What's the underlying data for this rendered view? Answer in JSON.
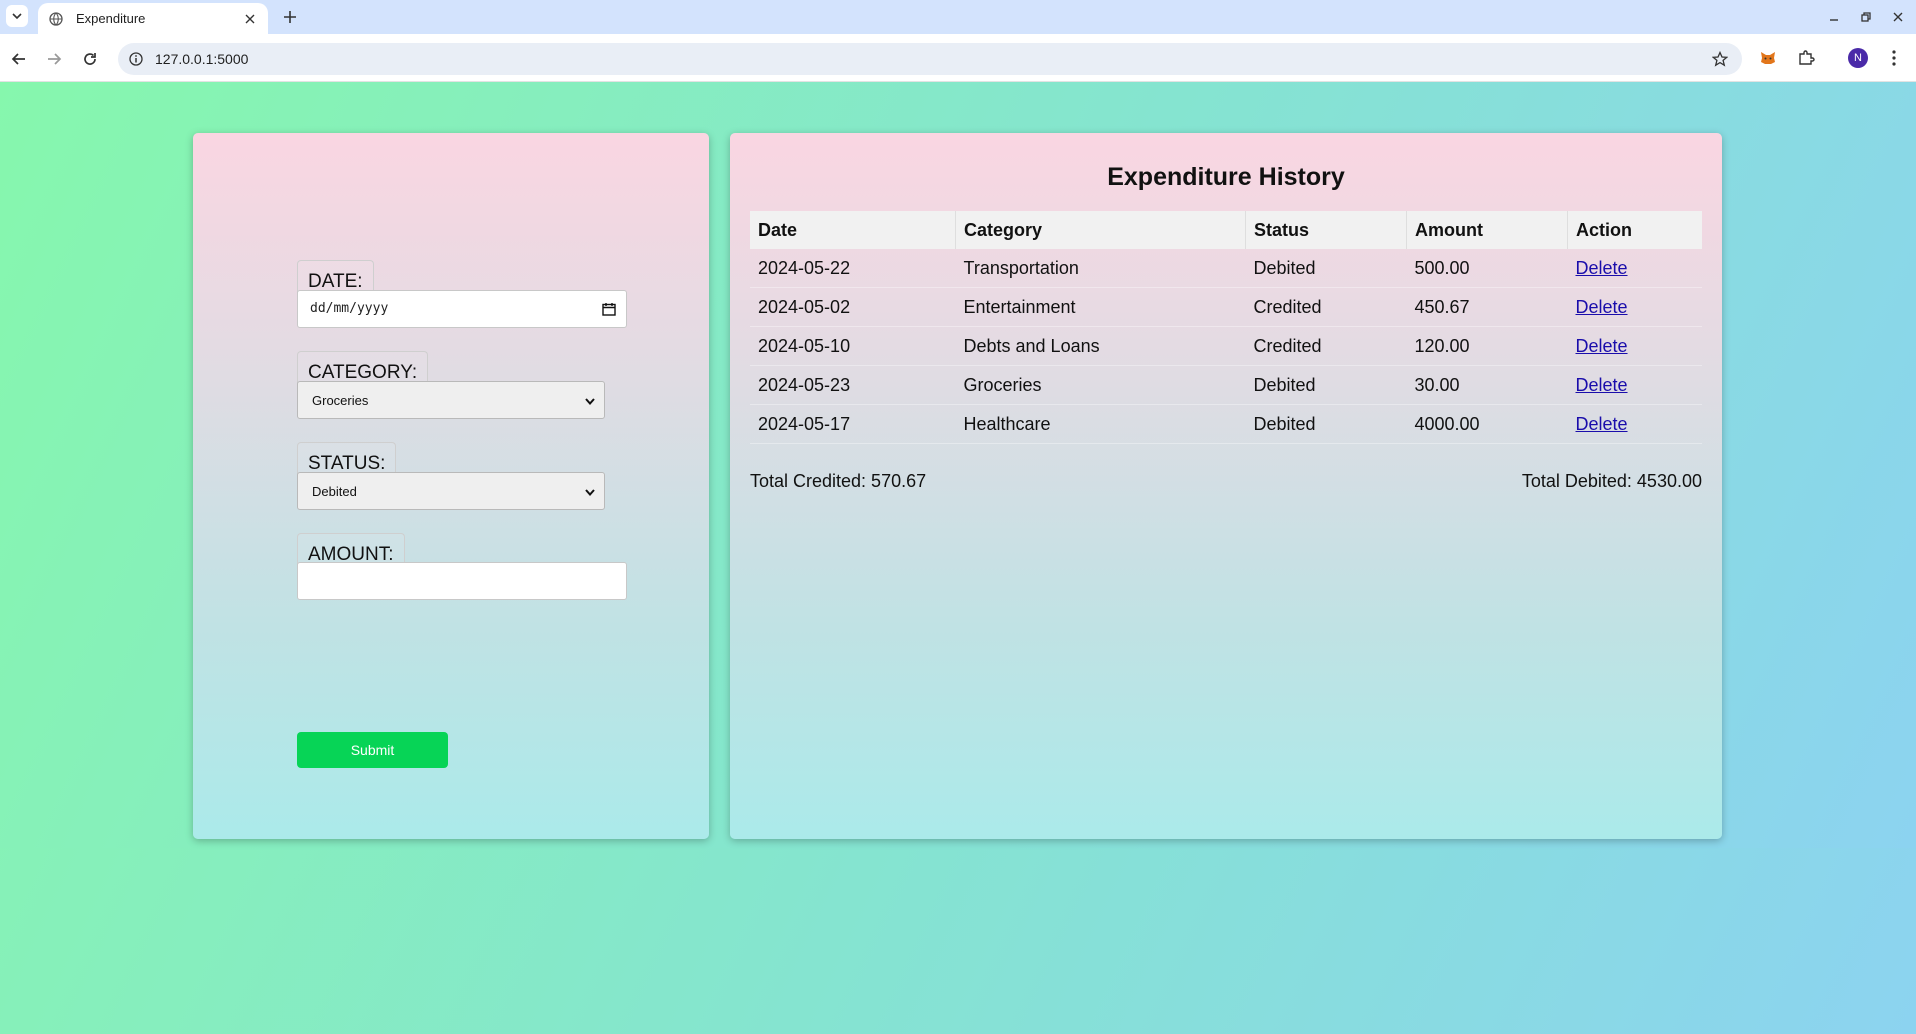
{
  "browser": {
    "tab_title": "Expenditure",
    "url": "127.0.0.1:5000",
    "profile_initial": "N"
  },
  "form": {
    "date_label": "DATE:",
    "date_placeholder": "dd/mm/yyyy",
    "category_label": "CATEGORY:",
    "category_value": "Groceries",
    "status_label": "STATUS:",
    "status_value": "Debited",
    "amount_label": "AMOUNT:",
    "amount_value": "",
    "submit_label": "Submit"
  },
  "history": {
    "title": "Expenditure History",
    "columns": [
      "Date",
      "Category",
      "Status",
      "Amount",
      "Action"
    ],
    "rows": [
      {
        "date": "2024-05-22",
        "category": "Transportation",
        "status": "Debited",
        "amount": "500.00",
        "action": "Delete"
      },
      {
        "date": "2024-05-02",
        "category": "Entertainment",
        "status": "Credited",
        "amount": "450.67",
        "action": "Delete"
      },
      {
        "date": "2024-05-10",
        "category": "Debts and Loans",
        "status": "Credited",
        "amount": "120.00",
        "action": "Delete"
      },
      {
        "date": "2024-05-23",
        "category": "Groceries",
        "status": "Debited",
        "amount": "30.00",
        "action": "Delete"
      },
      {
        "date": "2024-05-17",
        "category": "Healthcare",
        "status": "Debited",
        "amount": "4000.00",
        "action": "Delete"
      }
    ],
    "total_credited": "Total Credited: 570.67",
    "total_debited": "Total Debited: 4530.00"
  },
  "colors": {
    "submit": "#07d456",
    "link": "#1a0dab",
    "chrome_tabstrip": "#d3e3fd"
  }
}
